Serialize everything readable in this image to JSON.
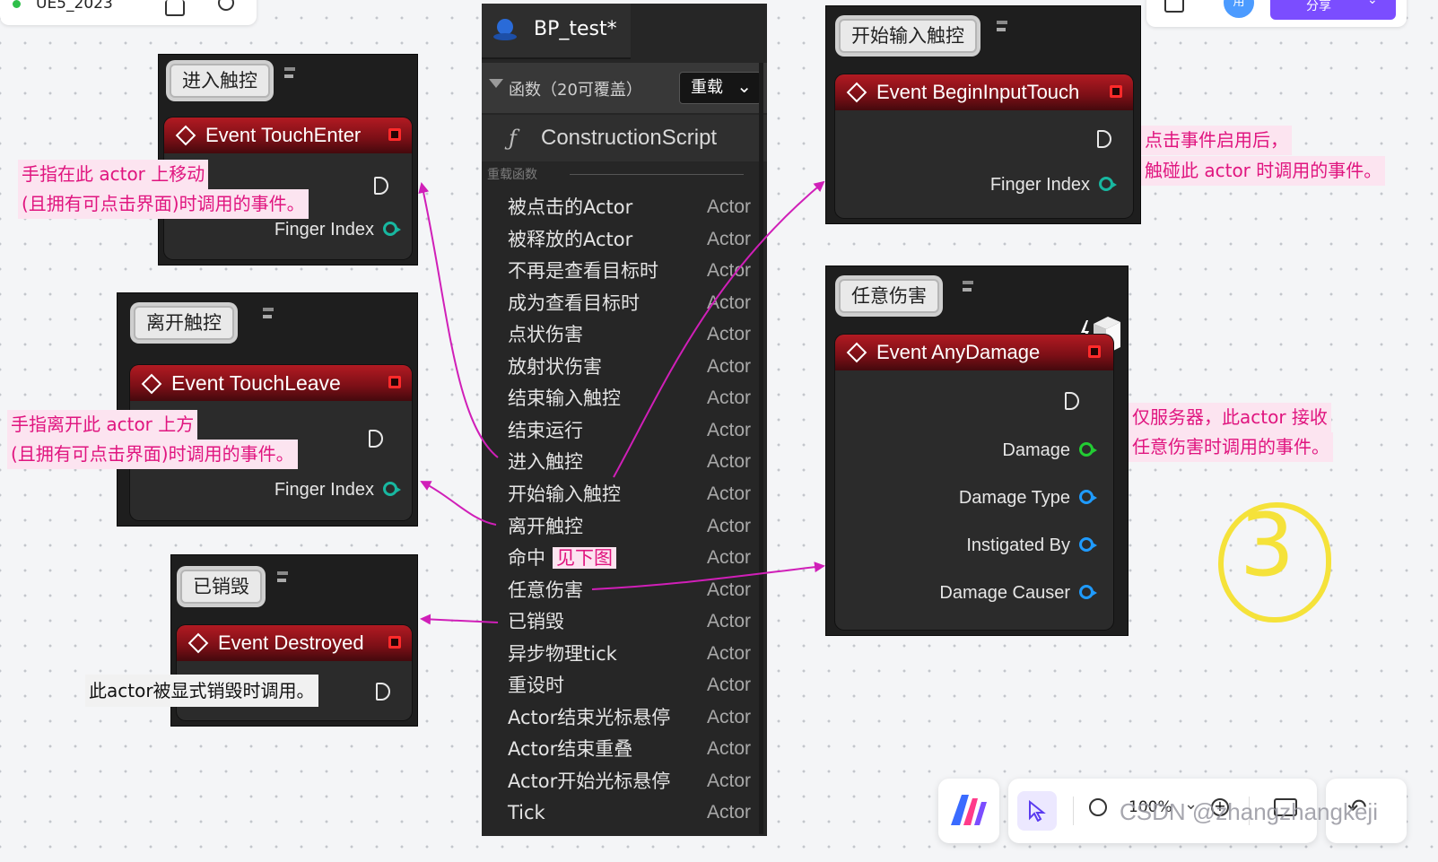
{
  "topbar": {
    "doc_title": "UE5_2023",
    "avatar_initial": "用",
    "share_label": "分享"
  },
  "panel": {
    "tab_title": "BP_test*",
    "functions_header": "函数（20可覆盖）",
    "override_label": "重载",
    "construction_script": "ConstructionScript",
    "group_label": "重载函数",
    "items": [
      {
        "name": "被点击的Actor",
        "type": "Actor"
      },
      {
        "name": "被释放的Actor",
        "type": "Actor"
      },
      {
        "name": "不再是查看目标时",
        "type": "Actor"
      },
      {
        "name": "成为查看目标时",
        "type": "Actor"
      },
      {
        "name": "点状伤害",
        "type": "Actor"
      },
      {
        "name": "放射状伤害",
        "type": "Actor"
      },
      {
        "name": "结束输入触控",
        "type": "Actor"
      },
      {
        "name": "结束运行",
        "type": "Actor"
      },
      {
        "name": "进入触控",
        "type": "Actor"
      },
      {
        "name": "开始输入触控",
        "type": "Actor"
      },
      {
        "name": "离开触控",
        "type": "Actor"
      },
      {
        "name": "命中",
        "type": "Actor"
      },
      {
        "name": "任意伤害",
        "type": "Actor"
      },
      {
        "name": "已销毁",
        "type": "Actor"
      },
      {
        "name": "异步物理tick",
        "type": "Actor"
      },
      {
        "name": "重设时",
        "type": "Actor"
      },
      {
        "name": "Actor结束光标悬停",
        "type": "Actor"
      },
      {
        "name": "Actor结束重叠",
        "type": "Actor"
      },
      {
        "name": "Actor开始光标悬停",
        "type": "Actor"
      },
      {
        "name": "Tick",
        "type": "Actor"
      }
    ],
    "hit_note": "见下图"
  },
  "nodes": {
    "touch_enter": {
      "tag": "进入触控",
      "title": "Event TouchEnter",
      "pin": "Finger Index"
    },
    "touch_leave": {
      "tag": "离开触控",
      "title": "Event TouchLeave",
      "pin": "Finger Index"
    },
    "destroyed": {
      "tag": "已销毁",
      "title": "Event Destroyed"
    },
    "begin_input_touch": {
      "tag": "开始输入触控",
      "title": "Event BeginInputTouch",
      "pin": "Finger Index"
    },
    "any_damage": {
      "tag": "任意伤害",
      "title": "Event AnyDamage",
      "pins": [
        "Damage",
        "Damage Type",
        "Instigated By",
        "Damage Causer"
      ]
    }
  },
  "notes": {
    "touch_enter_1": "手指在此 actor 上移动",
    "touch_enter_2": "(且拥有可点击界面)时调用的事件。",
    "touch_leave_1": "手指离开此 actor 上方",
    "touch_leave_2": "(且拥有可点击界面)时调用的事件。",
    "destroyed": "此actor被显式销毁时调用。",
    "begin_touch_1": "点击事件启用后，",
    "begin_touch_2": "触碰此 actor 时调用的事件。",
    "any_damage_1": "仅服务器，此actor 接收",
    "any_damage_2": "任意伤害时调用的事件。",
    "handwritten_number": "3"
  },
  "bottom_toolbar": {
    "zoom": "100%"
  },
  "watermark": "CSDN @zhangzhangkeji",
  "colors": {
    "annotation_pink": "#e0157f",
    "node_header_red": "#b21a22",
    "pin_green": "#22cc33",
    "pin_blue": "#1f9bff",
    "pin_teal": "#18b7a0",
    "handwriting_yellow": "#f5e23a",
    "share_purple": "#7b4dff"
  }
}
